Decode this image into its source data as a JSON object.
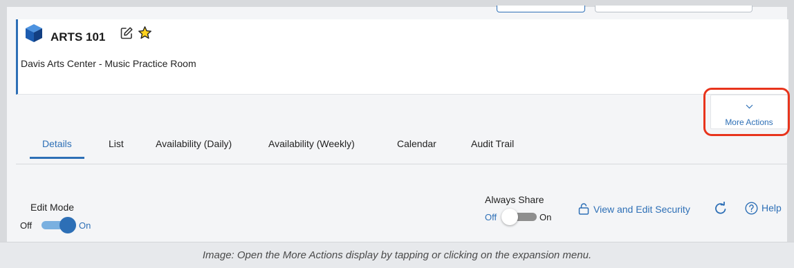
{
  "header": {
    "title": "ARTS 101",
    "location": "Davis Arts Center - Music Practice Room"
  },
  "more_actions": {
    "label": "More Actions"
  },
  "tabs": [
    {
      "label": "Details",
      "active": true
    },
    {
      "label": "List",
      "active": false
    },
    {
      "label": "Availability (Daily)",
      "active": false
    },
    {
      "label": "Availability (Weekly)",
      "active": false
    },
    {
      "label": "Calendar",
      "active": false
    },
    {
      "label": "Audit Trail",
      "active": false
    }
  ],
  "edit_mode": {
    "label": "Edit Mode",
    "off": "Off",
    "on": "On",
    "state": "on"
  },
  "always_share": {
    "label": "Always Share",
    "off": "Off",
    "on": "On",
    "state": "off"
  },
  "security_link": {
    "label": "View and Edit Security"
  },
  "help": {
    "label": "Help"
  },
  "caption": "Image: Open the More Actions display by tapping or clicking on the expansion menu.",
  "colors": {
    "accent": "#2d6fb6",
    "highlight": "#e8341c",
    "cube": "#1f5fb8"
  }
}
